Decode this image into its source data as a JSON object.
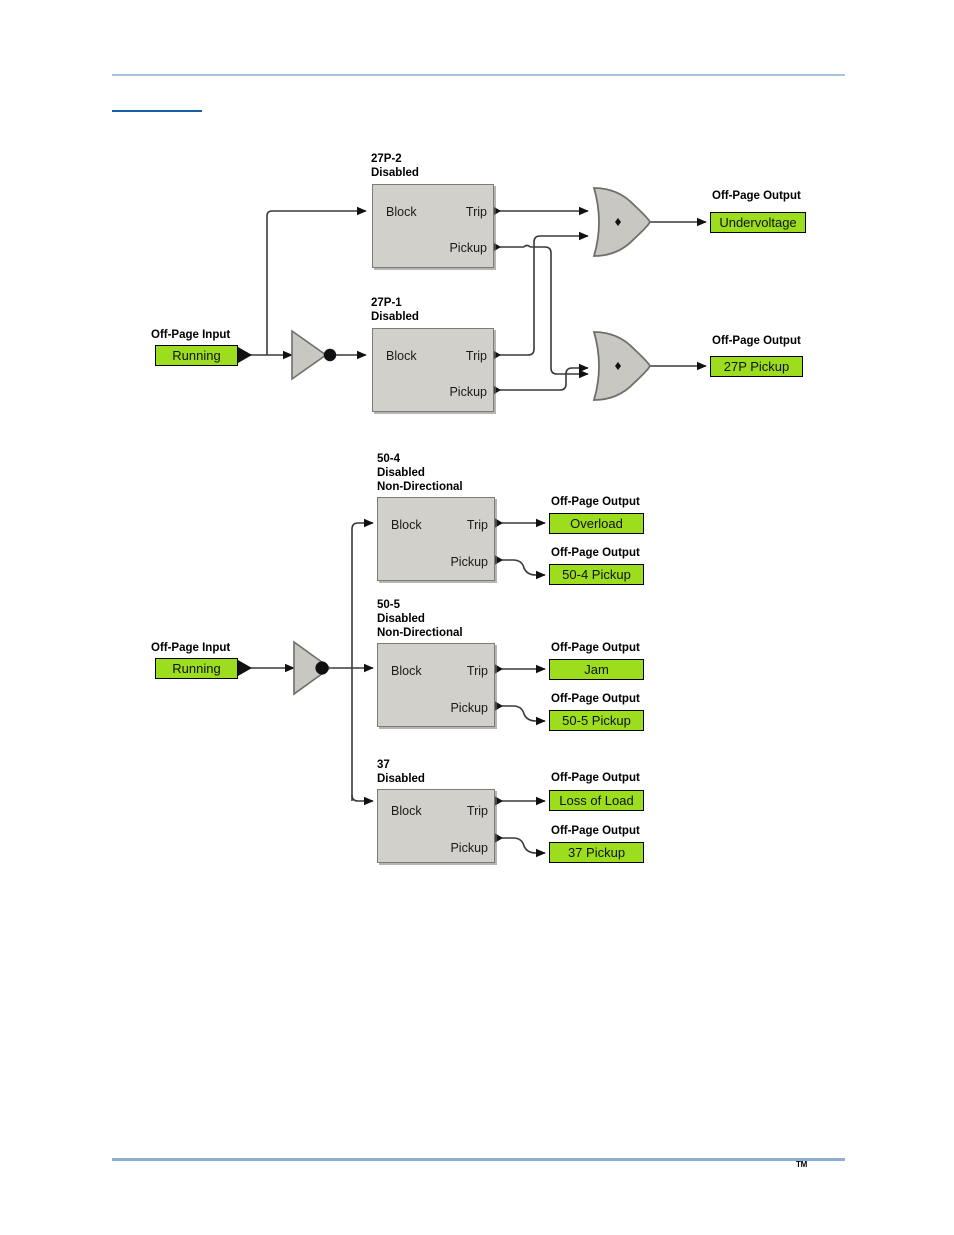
{
  "page": {
    "domain_note": "Protective relay logic diagram page",
    "footer_trademark": "TM"
  },
  "diagram_top": {
    "input": {
      "caption": "Off-Page Input",
      "value": "Running"
    },
    "blocks": [
      {
        "id": "27P-2",
        "title_lines": [
          "27P-2",
          "Disabled"
        ],
        "input_port": "Block",
        "output_ports": [
          "Trip",
          "Pickup"
        ]
      },
      {
        "id": "27P-1",
        "title_lines": [
          "27P-1",
          "Disabled"
        ],
        "input_port": "Block",
        "output_ports": [
          "Trip",
          "Pickup"
        ]
      }
    ],
    "gates": [
      {
        "id": "or-undervoltage",
        "type": "or"
      },
      {
        "id": "or-27p-pickup",
        "type": "or"
      }
    ],
    "outputs": [
      {
        "caption": "Off-Page Output",
        "value": "Undervoltage"
      },
      {
        "caption": "Off-Page Output",
        "value": "27P Pickup"
      }
    ]
  },
  "diagram_bottom": {
    "input": {
      "caption": "Off-Page Input",
      "value": "Running"
    },
    "blocks": [
      {
        "id": "50-4",
        "title_lines": [
          "50-4",
          "Disabled",
          "Non-Directional"
        ],
        "input_port": "Block",
        "output_ports": [
          "Trip",
          "Pickup"
        ]
      },
      {
        "id": "50-5",
        "title_lines": [
          "50-5",
          "Disabled",
          "Non-Directional"
        ],
        "input_port": "Block",
        "output_ports": [
          "Trip",
          "Pickup"
        ]
      },
      {
        "id": "37",
        "title_lines": [
          "37",
          "Disabled"
        ],
        "input_port": "Block",
        "output_ports": [
          "Trip",
          "Pickup"
        ]
      }
    ],
    "outputs": [
      {
        "caption": "Off-Page Output",
        "value": "Overload"
      },
      {
        "caption": "Off-Page Output",
        "value": "50-4 Pickup"
      },
      {
        "caption": "Off-Page Output",
        "value": "Jam"
      },
      {
        "caption": "Off-Page Output",
        "value": "50-5 Pickup"
      },
      {
        "caption": "Off-Page Output",
        "value": "Loss of Load"
      },
      {
        "caption": "Off-Page Output",
        "value": "37 Pickup"
      }
    ]
  },
  "colors": {
    "chip_green": "#9cdd1e",
    "block_gray": "#d2d0cb",
    "rule_blue_light": "#a8c2e0",
    "rule_blue_dark": "#1560ab",
    "wire_black": "#1a1a1a"
  }
}
